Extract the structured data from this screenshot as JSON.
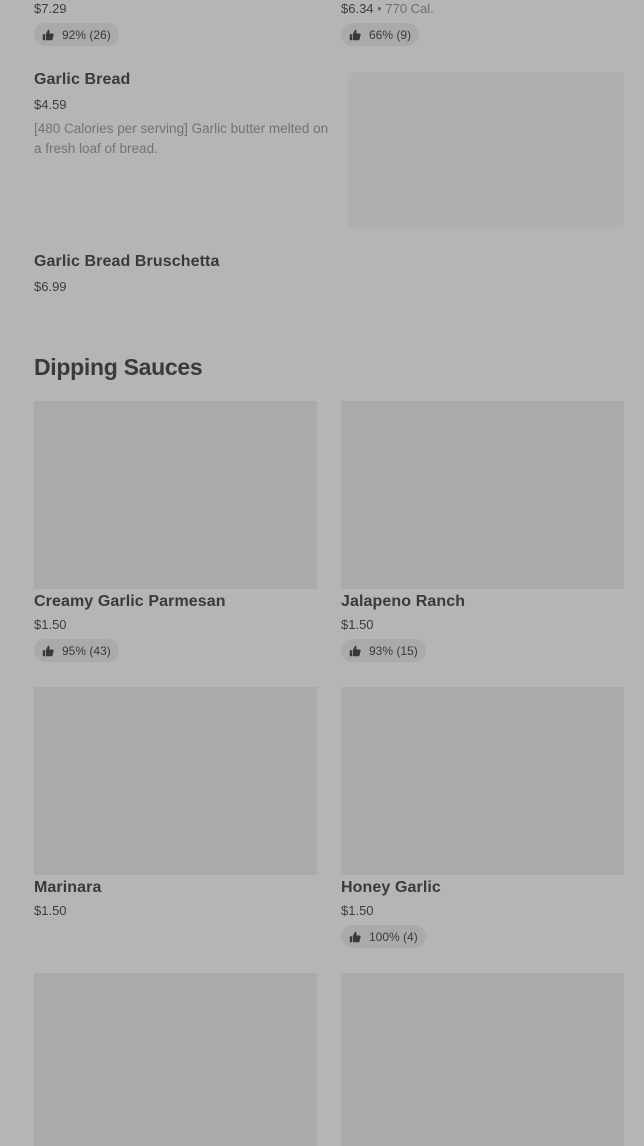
{
  "top_items": [
    {
      "price": "$7.29",
      "calories": "",
      "rating": "92% (26)"
    },
    {
      "price": "$6.34",
      "calories": "770 Cal.",
      "separator": "•",
      "rating": "66% (9)"
    }
  ],
  "garlic_bread": {
    "name": "Garlic Bread",
    "price": "$4.59",
    "description": "[480 Calories per serving] Garlic butter melted on a fresh loaf of bread."
  },
  "bruschetta": {
    "name": "Garlic Bread Bruschetta",
    "price": "$6.99"
  },
  "section": {
    "title": "Dipping Sauces"
  },
  "sauces": [
    {
      "name": "Creamy Garlic Parmesan",
      "price": "$1.50",
      "rating": "95% (43)"
    },
    {
      "name": "Jalapeno Ranch",
      "price": "$1.50",
      "rating": "93% (15)"
    },
    {
      "name": "Marinara",
      "price": "$1.50",
      "rating": ""
    },
    {
      "name": "Honey Garlic",
      "price": "$1.50",
      "rating": "100% (4)"
    }
  ],
  "icons": {
    "thumbs_up": "thumbs-up-icon"
  }
}
